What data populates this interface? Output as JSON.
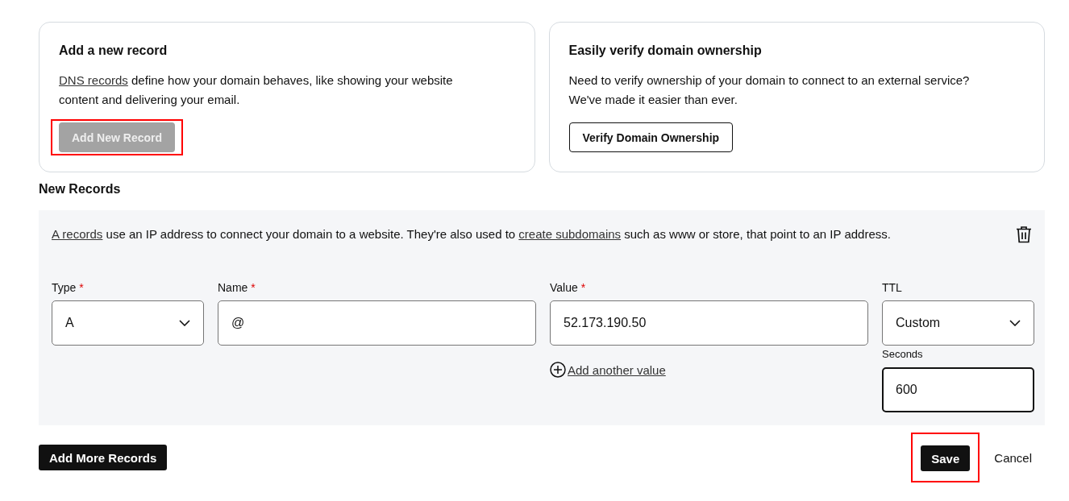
{
  "cards": [
    {
      "title": "Add a new record",
      "description": [
        {
          "kind": "link",
          "text": "DNS records"
        },
        {
          "kind": "text",
          "text": " define how your domain behaves, like showing your website content and delivering your email."
        }
      ],
      "button": {
        "label": "Add New Record",
        "disabled": true,
        "highlighted": true
      }
    },
    {
      "title": "Easily verify domain ownership",
      "description": [
        {
          "kind": "text",
          "text": "Need to verify ownership of your domain to connect to an external service? We've made it easier than ever."
        }
      ],
      "button": {
        "label": "Verify Domain Ownership",
        "disabled": false,
        "highlighted": false
      }
    }
  ],
  "section_title": "New Records",
  "record": {
    "info": [
      {
        "kind": "link",
        "text": "A records"
      },
      {
        "kind": "text",
        "text": " use an IP address to connect your domain to a website. They're also used to "
      },
      {
        "kind": "link",
        "text": "create subdomains"
      },
      {
        "kind": "text",
        "text": " such as www or store, that point to an IP address."
      }
    ],
    "fields": [
      {
        "kind": "select",
        "label": "Type",
        "required_mark": "*",
        "value": "A",
        "focused": false
      },
      {
        "kind": "text",
        "label": "Name",
        "required_mark": "*",
        "value": "@",
        "focused": false
      },
      {
        "kind": "text",
        "label": "Value",
        "required_mark": "*",
        "value": "52.173.190.50",
        "focused": false,
        "add_link": "Add another value"
      },
      {
        "kind": "select",
        "label": "TTL",
        "value": "Custom",
        "focused": false,
        "sub_field": {
          "label": "Seconds",
          "value": "600",
          "focused": true
        }
      }
    ]
  },
  "footer": {
    "add_more": {
      "label": "Add More Records",
      "highlighted": false
    },
    "save": {
      "label": "Save",
      "highlighted": true
    },
    "cancel": {
      "label": "Cancel"
    }
  }
}
